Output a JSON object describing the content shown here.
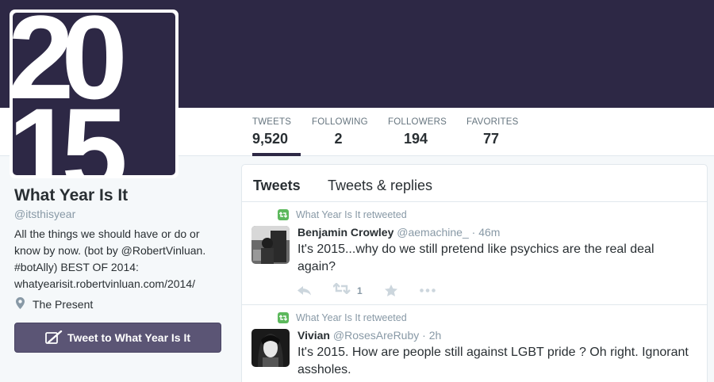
{
  "colors": {
    "banner": "#2d2845",
    "accent": "#5b5575",
    "retweet_green": "#5cb85c"
  },
  "avatar": {
    "text": "2015",
    "icon": "2015-logo"
  },
  "stats": [
    {
      "label": "TWEETS",
      "value": "9,520",
      "active": true
    },
    {
      "label": "FOLLOWING",
      "value": "2"
    },
    {
      "label": "FOLLOWERS",
      "value": "194"
    },
    {
      "label": "FAVORITES",
      "value": "77"
    }
  ],
  "profile": {
    "name": "What Year Is It",
    "handle": "@itsthisyear",
    "bio_text": "All the things we should have or do or know by now. (bot by ",
    "bio_mention": "@RobertVinluan",
    "bio_text2": ". #botAlly) BEST OF 2014: ",
    "bio_link": "whatyearisit.robertvinluan.com/2014/",
    "location": "The Present",
    "location_icon": "map-pin-icon",
    "tweet_to_label": "Tweet to What Year Is It"
  },
  "timeline": {
    "tabs": [
      "Tweets",
      "Tweets & replies"
    ],
    "tweets": [
      {
        "retweet_context": "What Year Is It retweeted",
        "author": "Benjamin Crowley",
        "handle": "@aemachine_",
        "dot": "·",
        "time": "46m",
        "text": "It's 2015...why do we still pretend like psychics are the real deal again?",
        "retweet_count": "1"
      },
      {
        "retweet_context": "What Year Is It retweeted",
        "author": "Vivian",
        "handle": "@RosesAreRuby",
        "dot": "·",
        "time": "2h",
        "text": "It's 2015. How are people still against LGBT pride ? Oh right. Ignorant assholes."
      }
    ]
  }
}
